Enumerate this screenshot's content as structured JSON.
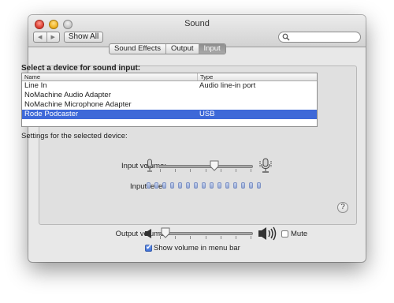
{
  "window": {
    "title": "Sound",
    "nav": {
      "back_icon": "◀",
      "forward_icon": "▶"
    },
    "show_all_label": "Show All",
    "search": {
      "value": ""
    }
  },
  "tabs": [
    {
      "label": "Sound Effects",
      "active": false
    },
    {
      "label": "Output",
      "active": false
    },
    {
      "label": "Input",
      "active": true
    }
  ],
  "input_panel": {
    "heading": "Select a device for sound input:",
    "columns": [
      "Name",
      "Type"
    ],
    "devices": [
      {
        "name": "Line In",
        "type": "Audio line-in port",
        "selected": false
      },
      {
        "name": "NoMachine Audio Adapter",
        "type": "",
        "selected": false
      },
      {
        "name": "NoMachine Microphone Adapter",
        "type": "",
        "selected": false
      },
      {
        "name": "Rode Podcaster",
        "type": "USB",
        "selected": true
      }
    ],
    "settings_label": "Settings for the selected device:",
    "input_volume_label": "Input volume:",
    "input_volume_level": 0.6,
    "input_level_label": "Input level:",
    "input_level_segments": 15,
    "input_level_lit": 0
  },
  "help_label": "?",
  "output": {
    "volume_label": "Output volume:",
    "volume_level": 0.08,
    "mute_label": "Mute",
    "mute_checked": false,
    "show_volume_label": "Show volume in menu bar",
    "show_volume_checked": true
  },
  "colors": {
    "selection": "#3e69d8",
    "active_tab": "#9a9a9a"
  }
}
